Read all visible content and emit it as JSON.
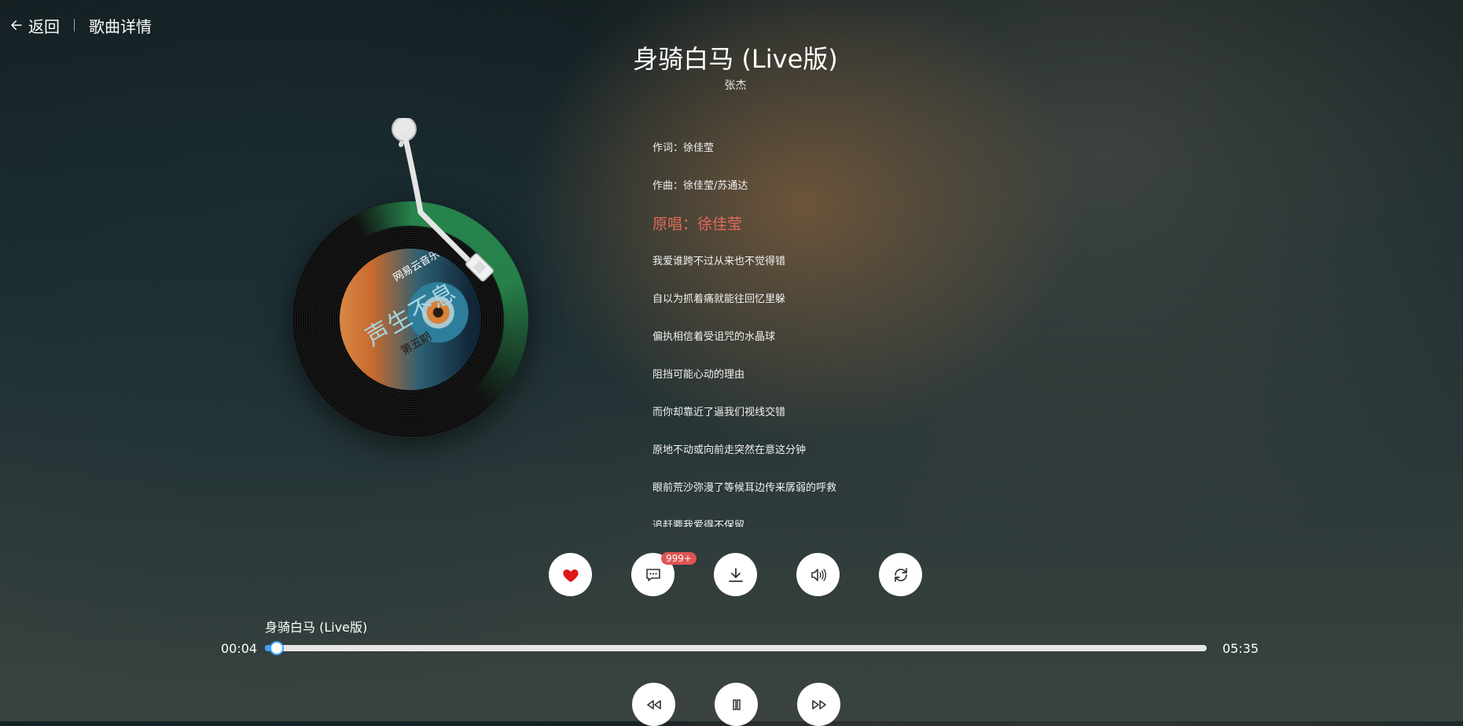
{
  "header": {
    "back_label": "返回",
    "page_title": "歌曲详情"
  },
  "song": {
    "title": "身骑白马 (Live版)",
    "singer": "张杰"
  },
  "album_art": {
    "main_text": "声生不息",
    "sub_text": "第五期",
    "brand": "网易云音乐"
  },
  "lyrics": [
    "作词：徐佳莹",
    "作曲：徐佳莹/苏通达",
    "原唱：徐佳莹",
    "我爱谁跨不过从来也不觉得错",
    "自以为抓着痛就能往回忆里躲",
    "偏执相信着受诅咒的水晶球",
    "阻挡可能心动的理由",
    "而你却靠近了逼我们视线交错",
    "原地不动或向前走突然在意这分钟",
    "眼前荒沙弥漫了等候耳边传来孱弱的呼救",
    "追赶要我爱得不保留"
  ],
  "active_lyric_index": 2,
  "actions": {
    "like_icon": "heart-icon",
    "comment_icon": "comment-icon",
    "comment_badge": "999+",
    "download_icon": "download-icon",
    "sound_effect_icon": "sound-effect-icon",
    "loop_icon": "loop-icon"
  },
  "player": {
    "now_playing": "身骑白马 (Live版)",
    "current_time": "00:04",
    "total_time": "05:35",
    "progress": 0.0123
  },
  "colors": {
    "accent": "#409eff",
    "active_lyric": "#e26a5c",
    "like": "#e01818",
    "badge": "#e05353"
  }
}
